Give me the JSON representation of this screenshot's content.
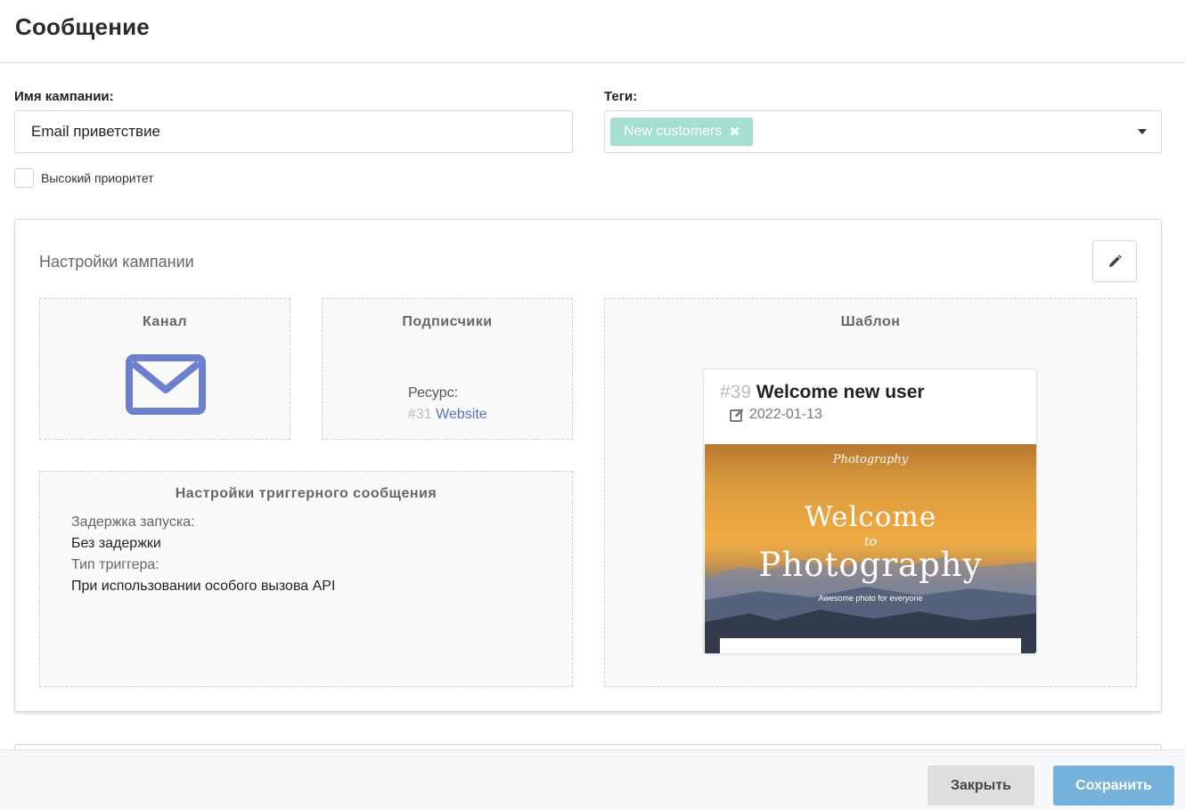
{
  "header": {
    "title": "Сообщение"
  },
  "form": {
    "campaign_name_label": "Имя кампании:",
    "campaign_name_value": "Email приветствие",
    "tags_label": "Теги:",
    "tags": [
      {
        "label": "New customers",
        "remove_glyph": "✖"
      }
    ],
    "priority_label": "Высокий приоритет",
    "priority_checked": false
  },
  "settings": {
    "title": "Настройки кампании",
    "channel": {
      "title": "Канал",
      "icon": "envelope-icon",
      "icon_color": "#6f7fcf"
    },
    "subscribers": {
      "title": "Подписчики",
      "resource_label": "Ресурс:",
      "resource_id": "#31",
      "resource_name": "Website"
    },
    "trigger": {
      "title": "Настройки триггерного сообщения",
      "delay_label": "Задержка запуска:",
      "delay_value": "Без задержки",
      "type_label": "Тип триггера:",
      "type_value": "При использовании особого вызова API"
    },
    "template": {
      "title": "Шаблон",
      "id": "#39",
      "name": "Welcome new user",
      "date": "2022-01-13",
      "image_texts": {
        "brand": "Photography",
        "welcome": "Welcome",
        "to": "to",
        "photography": "Photography",
        "tagline": "Awesome photo for everyone"
      }
    }
  },
  "footer": {
    "close_label": "Закрыть",
    "save_label": "Сохранить"
  },
  "colors": {
    "tag_bg": "#a5dfd0",
    "link": "#5b6fc5",
    "save_bg": "#75b3dd",
    "close_bg": "#dedede"
  }
}
